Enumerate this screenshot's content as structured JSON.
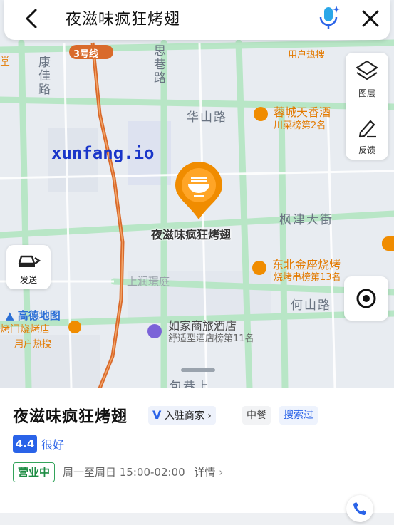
{
  "search": {
    "query": "夜滋味疯狂烤翅"
  },
  "map": {
    "metro_line": "3号线",
    "roads": [
      "康佳路",
      "思巷路",
      "华山路",
      "枫津大街",
      "何山路",
      "包巷上",
      "上润璟庭"
    ],
    "pois": [
      {
        "name": "蓉城天香酒",
        "sub": "川菜榜第2名"
      },
      {
        "name": "东北金座烧烤",
        "sub": "烧烤串榜第13名"
      },
      {
        "name": "如家商旅酒店",
        "sub": "舒适型酒店榜第11名"
      },
      {
        "name": "用户热搜"
      },
      {
        "name": "用户热搜"
      },
      {
        "name": "烤门烧烤店"
      },
      {
        "name": "堂"
      }
    ],
    "selected_label": "夜滋味疯狂烤翅",
    "amap_logo": "高德地图",
    "watermark": "xunfang.io"
  },
  "side_controls": {
    "layers_label": "图层",
    "feedback_label": "反馈"
  },
  "send_label": "发送",
  "place": {
    "name": "夜滋味疯狂烤翅",
    "badges": {
      "merchant": "入驻商家",
      "cuisine": "中餐",
      "searched": "搜索过"
    },
    "rating": "4.4",
    "rating_text": "很好",
    "status": "营业中",
    "hours": "周一至周日 15:00-02:00",
    "details": "详情"
  },
  "colors": {
    "accent": "#2a63e8",
    "pin": "#f08c00",
    "metro": "#d96a2b",
    "open": "#1e8d44"
  }
}
